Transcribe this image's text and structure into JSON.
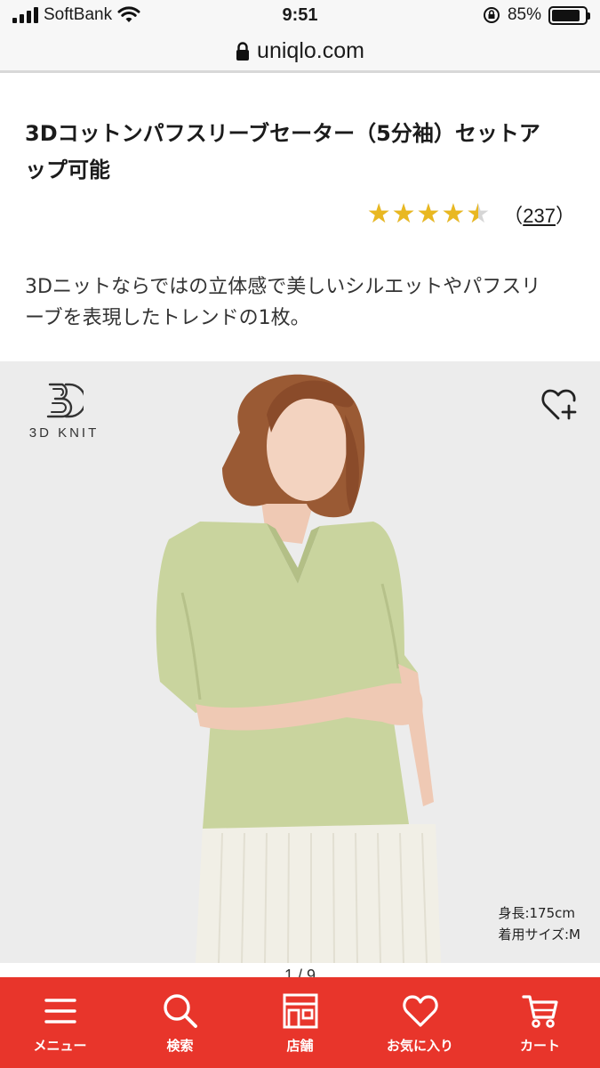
{
  "status_bar": {
    "carrier": "SoftBank",
    "time": "9:51",
    "battery": "85%",
    "battery_level": 0.85
  },
  "url_bar": {
    "domain": "uniqlo.com"
  },
  "product": {
    "title_line1": "3Dコットンパフスリーブセーター（5分袖）セットア",
    "title_line2": "ップ可能",
    "rating": 4.5,
    "stars": "★★★★★",
    "review_count_open": "（",
    "review_count": "237",
    "review_count_close": "）",
    "description_line1": "3Dニットならではの立体感で美しいシルエットやパフスリ",
    "description_line2": "ーブを表現したトレンドの1枚。",
    "badge_label": "3D KNIT",
    "model_height": "身長:175cm",
    "model_size": "着用サイズ:M",
    "pager": "1 / 9",
    "sweater_color": "#c9d49e",
    "image_bg": "#ececec"
  },
  "bottom_nav": {
    "items": [
      {
        "label": "メニュー",
        "icon": "menu-icon"
      },
      {
        "label": "検索",
        "icon": "search-icon"
      },
      {
        "label": "店舗",
        "icon": "store-icon"
      },
      {
        "label": "お気に入り",
        "icon": "heart-icon"
      },
      {
        "label": "カート",
        "icon": "cart-icon"
      }
    ]
  },
  "colors": {
    "brand_red": "#e8352b",
    "star": "#e9b821"
  }
}
